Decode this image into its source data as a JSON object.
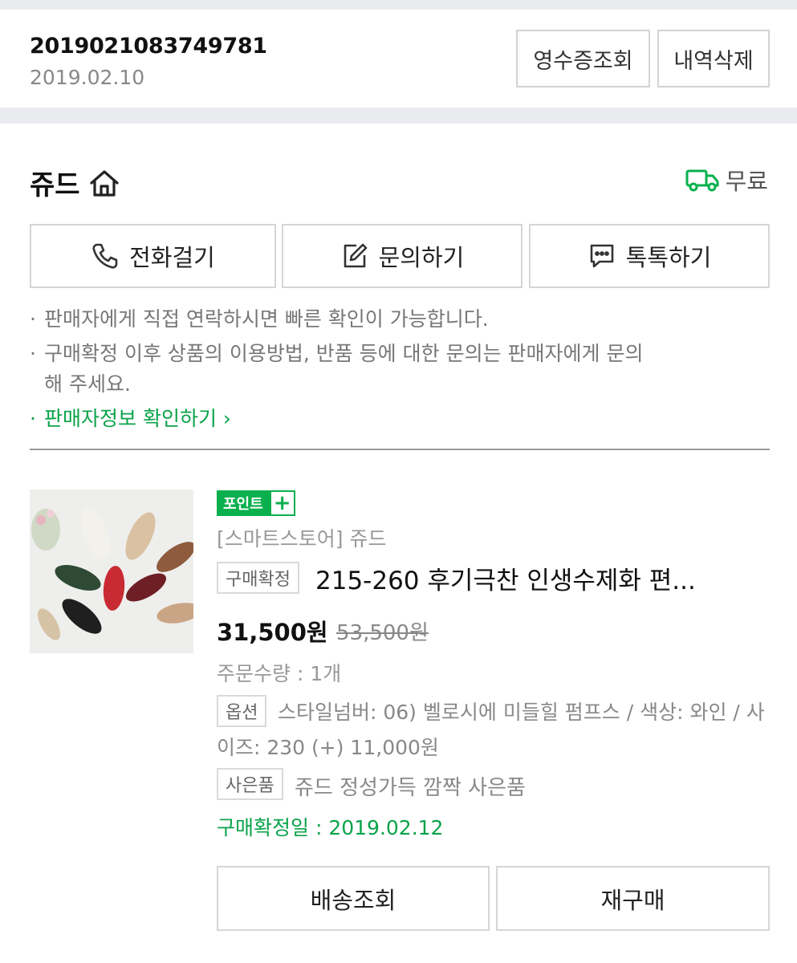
{
  "order": {
    "number": "2019021083749781",
    "date": "2019.02.10",
    "receipt_label": "영수증조회",
    "delete_label": "내역삭제"
  },
  "seller": {
    "name": "쥬드",
    "shipping_label": "무료",
    "call_label": "전화걸기",
    "inquiry_label": "문의하기",
    "talk_label": "톡톡하기"
  },
  "notices": {
    "line1": "판매자에게 직접 연락하시면 빠른 확인이 가능합니다.",
    "line2": "구매확정 이후 상품의 이용방법, 반품 등에 대한 문의는 판매자에게 문의",
    "line2_cont": "해 주세요.",
    "seller_info_link": "판매자정보 확인하기"
  },
  "product": {
    "point_badge": "포인트",
    "point_plus": "+",
    "store": "[스마트스토어] 쥬드",
    "status_tag": "구매확정",
    "title": "215-260 후기극찬 인생수제화 편...",
    "price": "31,500원",
    "original_price": "53,500원",
    "quantity": "주문수량 : 1개",
    "option_tag": "옵션",
    "option_text": "스타일넘버: 06) 벨로시에 미들힐 펌프스 / 색상: 와인 / 사이즈: 230 (+) 11,000원",
    "gift_tag": "사은품",
    "gift_text": "쥬드 정성가득 깜짝 사은품",
    "confirm_date": "구매확정일 : 2019.02.12"
  },
  "buttons": {
    "track_label": "배송조회",
    "rebuy_label": "재구매"
  },
  "colors": {
    "accent_green": "#0aa34a",
    "badge_green": "#0ab04d",
    "border_gray": "#d6d6d6",
    "band_gray": "#e9ebee"
  },
  "icons": {
    "home": "home-icon",
    "truck": "truck-icon",
    "phone": "phone-icon",
    "edit": "edit-icon",
    "chat": "chat-icon"
  }
}
